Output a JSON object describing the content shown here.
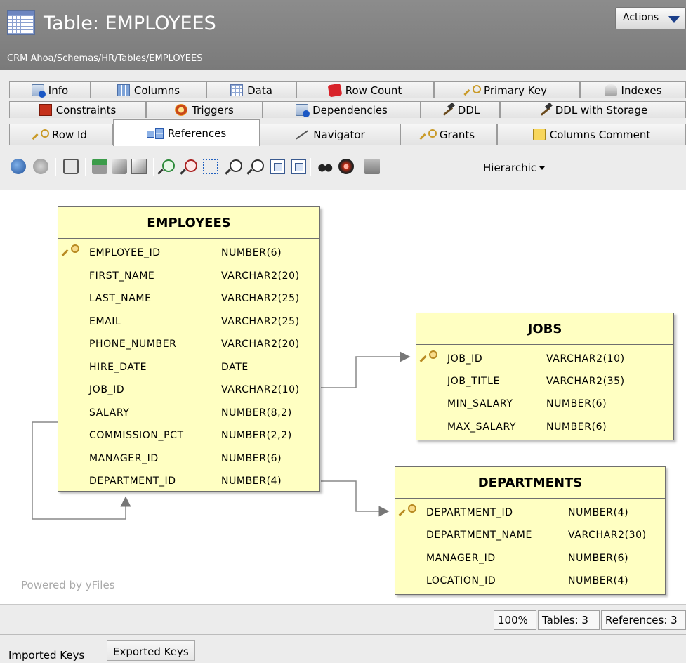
{
  "header": {
    "title": "Table: EMPLOYEES",
    "path": "CRM Ahoa/Schemas/HR/Tables/EMPLOYEES",
    "actions_label": "Actions"
  },
  "tabs": {
    "row1": [
      "Info",
      "Columns",
      "Data",
      "Row Count",
      "Primary Key",
      "Indexes"
    ],
    "row2": [
      "Constraints",
      "Triggers",
      "Dependencies",
      "DDL",
      "DDL with Storage"
    ],
    "row3": [
      "Row Id",
      "References",
      "Navigator",
      "Grants",
      "Columns Comment"
    ],
    "active": "References"
  },
  "toolbar": {
    "layout_mode": "Hierarchic",
    "icons": [
      "refresh-icon",
      "stop-icon",
      "clipboard-icon",
      "print-icon",
      "export-icon",
      "preview-icon",
      "zoom-in-icon",
      "zoom-out-icon",
      "marquee-icon",
      "zoom-actual-icon",
      "zoom-icon",
      "fit-content-icon",
      "fit-selection-icon",
      "binoculars-icon",
      "navigate-icon",
      "overview-icon"
    ]
  },
  "diagram": {
    "watermark": "Powered by yFiles",
    "entities": [
      {
        "name": "EMPLOYEES",
        "columns": [
          {
            "name": "EMPLOYEE_ID",
            "type": "NUMBER(6)",
            "pk": true
          },
          {
            "name": "FIRST_NAME",
            "type": "VARCHAR2(20)",
            "pk": false
          },
          {
            "name": "LAST_NAME",
            "type": "VARCHAR2(25)",
            "pk": false
          },
          {
            "name": "EMAIL",
            "type": "VARCHAR2(25)",
            "pk": false
          },
          {
            "name": "PHONE_NUMBER",
            "type": "VARCHAR2(20)",
            "pk": false
          },
          {
            "name": "HIRE_DATE",
            "type": "DATE",
            "pk": false
          },
          {
            "name": "JOB_ID",
            "type": "VARCHAR2(10)",
            "pk": false
          },
          {
            "name": "SALARY",
            "type": "NUMBER(8,2)",
            "pk": false
          },
          {
            "name": "COMMISSION_PCT",
            "type": "NUMBER(2,2)",
            "pk": false
          },
          {
            "name": "MANAGER_ID",
            "type": "NUMBER(6)",
            "pk": false
          },
          {
            "name": "DEPARTMENT_ID",
            "type": "NUMBER(4)",
            "pk": false
          }
        ]
      },
      {
        "name": "JOBS",
        "columns": [
          {
            "name": "JOB_ID",
            "type": "VARCHAR2(10)",
            "pk": true
          },
          {
            "name": "JOB_TITLE",
            "type": "VARCHAR2(35)",
            "pk": false
          },
          {
            "name": "MIN_SALARY",
            "type": "NUMBER(6)",
            "pk": false
          },
          {
            "name": "MAX_SALARY",
            "type": "NUMBER(6)",
            "pk": false
          }
        ]
      },
      {
        "name": "DEPARTMENTS",
        "columns": [
          {
            "name": "DEPARTMENT_ID",
            "type": "NUMBER(4)",
            "pk": true
          },
          {
            "name": "DEPARTMENT_NAME",
            "type": "VARCHAR2(30)",
            "pk": false
          },
          {
            "name": "MANAGER_ID",
            "type": "NUMBER(6)",
            "pk": false
          },
          {
            "name": "LOCATION_ID",
            "type": "NUMBER(4)",
            "pk": false
          }
        ]
      }
    ]
  },
  "status": {
    "zoom": "100%",
    "tables": "Tables: 3",
    "references": "References: 3"
  },
  "bottom_tabs": [
    "Imported Keys",
    "Exported Keys"
  ]
}
